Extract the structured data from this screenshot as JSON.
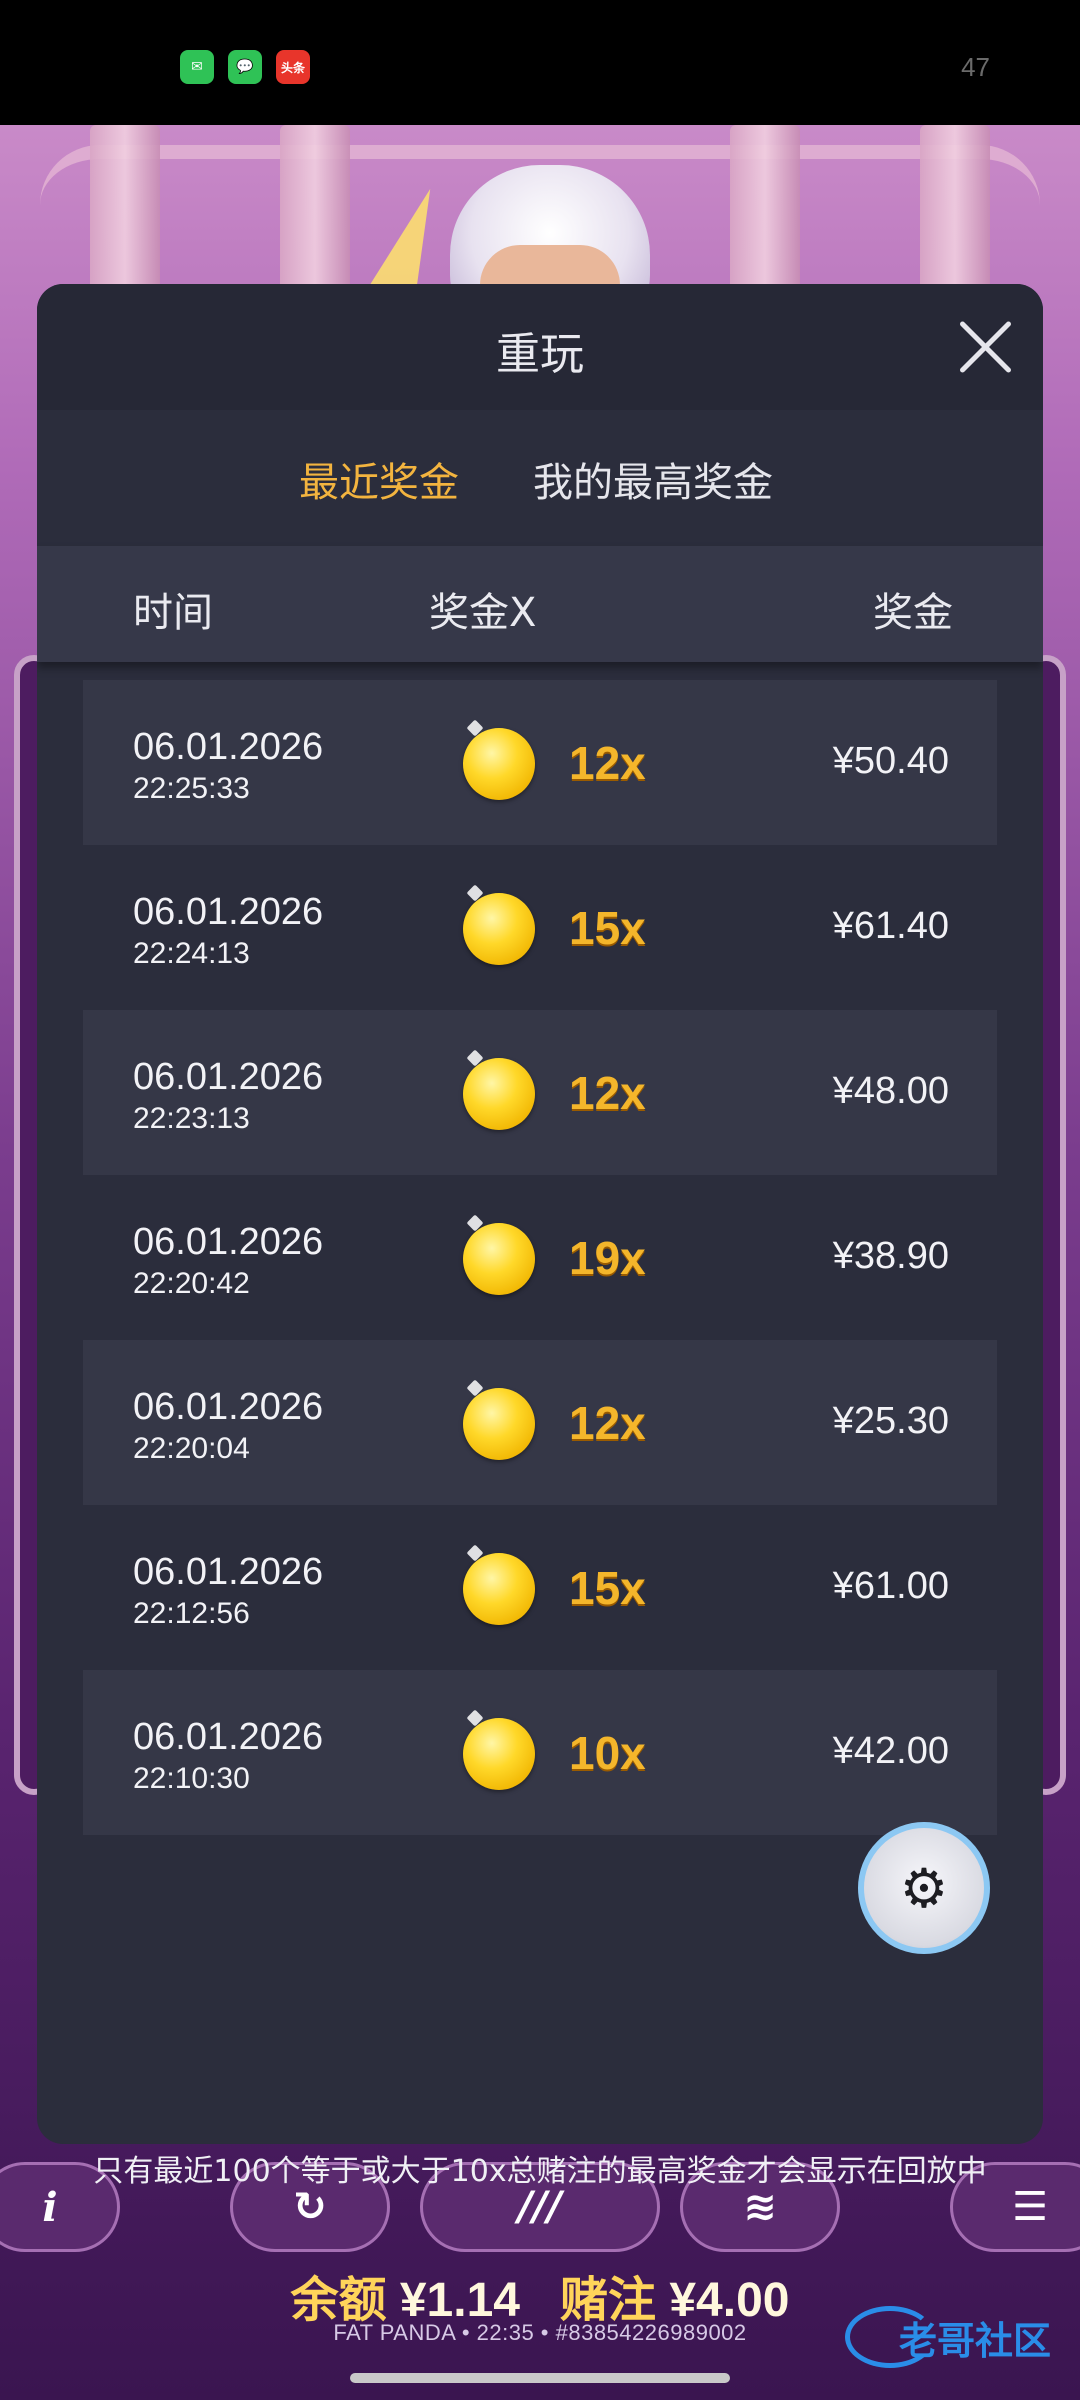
{
  "status_bar": {
    "apps": [
      {
        "name": "wechat-icon",
        "glyph": "✉"
      },
      {
        "name": "messages-icon",
        "glyph": "💬"
      },
      {
        "name": "toutiao-icon",
        "glyph": "头条"
      }
    ],
    "right_number": "47"
  },
  "modal": {
    "title": "重玩",
    "tabs": [
      {
        "label": "最近奖金",
        "active": true
      },
      {
        "label": "我的最高奖金",
        "active": false
      }
    ],
    "columns": {
      "time": "时间",
      "multiplier": "奖金X",
      "win": "奖金"
    },
    "rows": [
      {
        "date": "06.01.2026",
        "time": "22:25:33",
        "multiplier": "12x",
        "amount": "¥50.40"
      },
      {
        "date": "06.01.2026",
        "time": "22:24:13",
        "multiplier": "15x",
        "amount": "¥61.40"
      },
      {
        "date": "06.01.2026",
        "time": "22:23:13",
        "multiplier": "12x",
        "amount": "¥48.00"
      },
      {
        "date": "06.01.2026",
        "time": "22:20:42",
        "multiplier": "19x",
        "amount": "¥38.90"
      },
      {
        "date": "06.01.2026",
        "time": "22:20:04",
        "multiplier": "12x",
        "amount": "¥25.30"
      },
      {
        "date": "06.01.2026",
        "time": "22:12:56",
        "multiplier": "15x",
        "amount": "¥61.00"
      },
      {
        "date": "06.01.2026",
        "time": "22:10:30",
        "multiplier": "10x",
        "amount": "¥42.00"
      }
    ],
    "footnote": "只有最近100个等于或大于10x总赌注的最高奖金才会显示在回放中"
  },
  "game": {
    "balance_label": "余额",
    "balance_value": "¥1.14",
    "bet_label": "赌注",
    "bet_value": "¥4.00",
    "sub_line": "FAT PANDA • 22:35 • #83854226989002",
    "watermark": "老哥社区",
    "controls": {
      "info": "i",
      "spin": "↻",
      "turbo": "///",
      "coins": "≋",
      "menu": "☰"
    }
  },
  "colors": {
    "accent": "#f3b43f",
    "modal_bg": "#2b2d3c",
    "row_shaded": "#353747"
  }
}
